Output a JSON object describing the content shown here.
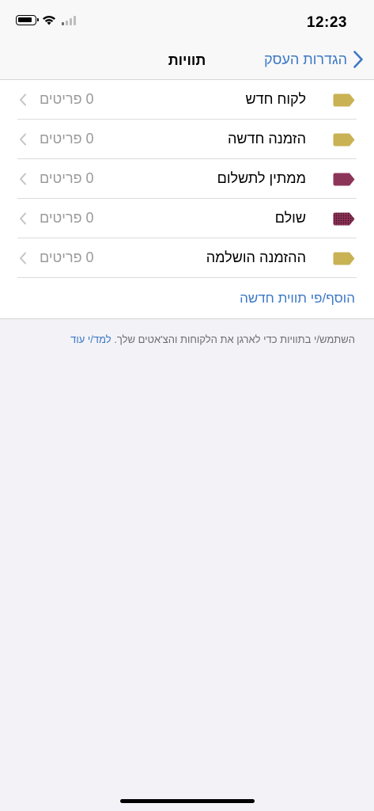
{
  "status": {
    "time": "12:23"
  },
  "nav": {
    "title": "תוויות",
    "back_label": "הגדרות העסק"
  },
  "tags": [
    {
      "label": "לקוח חדש",
      "count": "0 פריטים",
      "color": "#c8b254",
      "icon": "tag-icon"
    },
    {
      "label": "הזמנה חדשה",
      "count": "0 פריטים",
      "color": "#c8b254",
      "icon": "tag-icon"
    },
    {
      "label": "ממתין לתשלום",
      "count": "0 פריטים",
      "color": "#8c3559",
      "icon": "tag-icon"
    },
    {
      "label": "שולם",
      "count": "0 פריטים",
      "color": "#8c2f54",
      "icon": "tag-icon"
    },
    {
      "label": "ההזמנה הושלמה",
      "count": "0 פריטים",
      "color": "#c8b254",
      "icon": "tag-icon"
    }
  ],
  "add_label": "הוסף/פי תווית חדשה",
  "footer": {
    "text": "השתמש/י בתוויות כדי לארגן את הלקוחות והצ'אטים שלך.",
    "link": "למד/י עוד"
  },
  "colors": {
    "accent": "#3c78c6"
  }
}
